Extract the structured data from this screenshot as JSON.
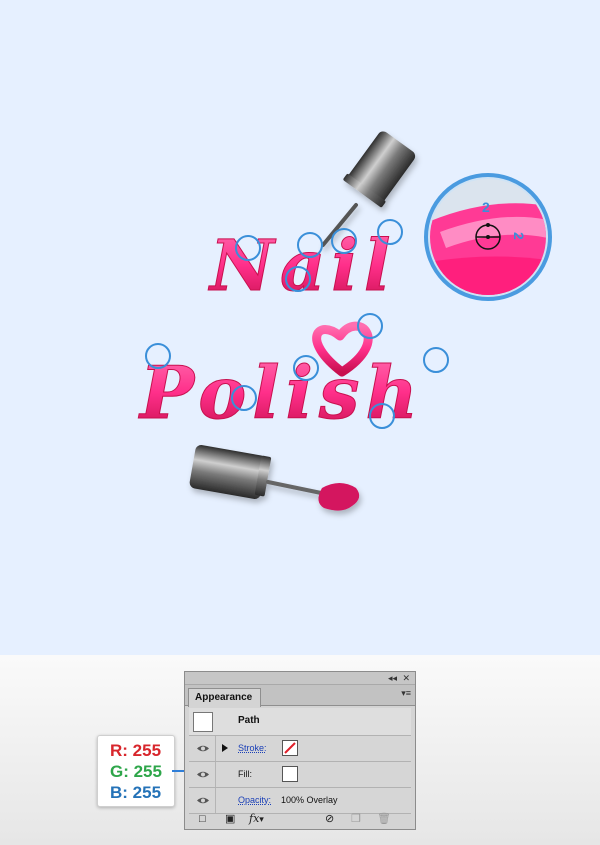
{
  "artwork": {
    "word1": "Nail",
    "word2": "Polish",
    "zoom_label": "2",
    "colors": {
      "background": "#e6f0ff",
      "polish_pink": "#ff2f8a",
      "polish_dark": "#d4145f",
      "anchor_blue": "#3a8fd9",
      "metal_dark": "#3c3c3c",
      "metal_light": "#bdbdbd"
    }
  },
  "panel": {
    "tab": "Appearance",
    "title_row": "Path",
    "stroke_label": "Stroke:",
    "fill_label": "Fill:",
    "opacity_label": "Opacity:",
    "opacity_value": "100% Overlay",
    "menu_icon": "panel-menu-icon",
    "collapse_icon": "double-arrow-icon",
    "close_icon": "close-icon"
  },
  "rgb": {
    "r": "R: 255",
    "g": "G: 255",
    "b": "B: 255",
    "r_color": "#d8262c",
    "g_color": "#2ea64a",
    "b_color": "#2573b8"
  }
}
